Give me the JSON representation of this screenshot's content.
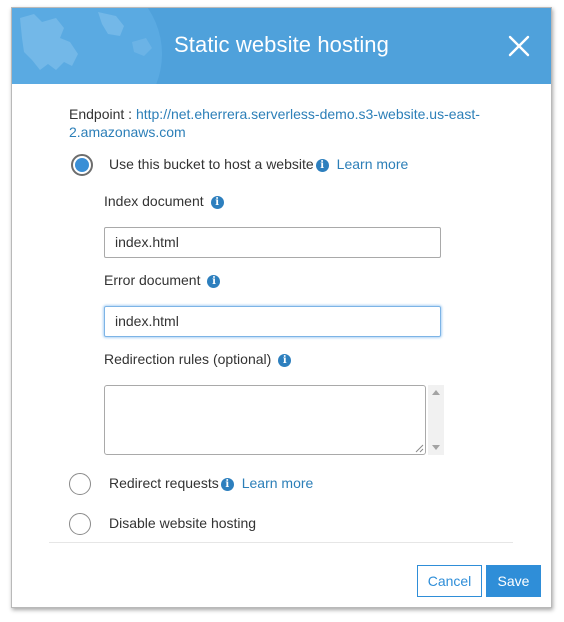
{
  "dialog": {
    "title": "Static website hosting",
    "endpoint_label": "Endpoint :",
    "endpoint_url": "http://net.eherrera.serverless-demo.s3-website.us-east-2.amazonaws.com"
  },
  "options": {
    "host": {
      "label": "Use this bucket to host a website",
      "learn_more": "Learn more",
      "selected": true
    },
    "redirect": {
      "label": "Redirect requests",
      "learn_more": "Learn more",
      "selected": false
    },
    "disable": {
      "label": "Disable website hosting",
      "selected": false
    }
  },
  "fields": {
    "index_label": "Index document",
    "index_value": "index.html",
    "error_label": "Error document",
    "error_value": "index.html",
    "redirection_label": "Redirection rules (optional)",
    "redirection_value": ""
  },
  "footer": {
    "cancel_label": "Cancel",
    "save_label": "Save"
  },
  "colors": {
    "header": "#4fa1db",
    "link": "#2c7fb8",
    "primary": "#2f8ed8",
    "radio_selected": "#3a8fd6"
  },
  "icons": {
    "close": "close-icon",
    "info": "info-icon",
    "header_decoration": "globe-icon"
  }
}
